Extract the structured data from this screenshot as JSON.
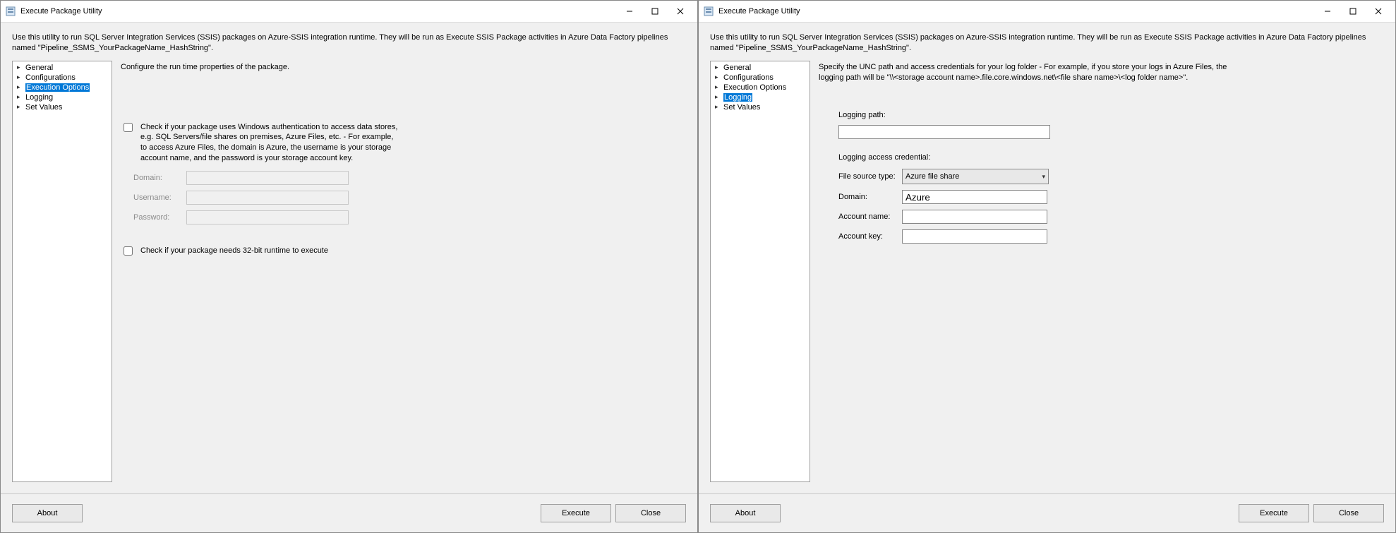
{
  "window_title": "Execute Package Utility",
  "description": "Use this utility to run SQL Server Integration Services (SSIS) packages on Azure-SSIS integration runtime. They will be run as Execute SSIS Package activities in Azure Data Factory pipelines named \"Pipeline_SSMS_YourPackageName_HashString\".",
  "nav": {
    "items": [
      "General",
      "Configurations",
      "Execution Options",
      "Logging",
      "Set Values"
    ]
  },
  "left": {
    "heading": "Configure the run time properties of the package.",
    "auth_checkbox_label": "Check if your package uses Windows authentication to access data stores, e.g. SQL Servers/file shares on premises, Azure Files, etc. - For example, to access Azure Files, the domain is Azure, the username is your storage account name, and the password is your storage account key.",
    "domain_label": "Domain:",
    "username_label": "Username:",
    "password_label": "Password:",
    "domain_value": "",
    "username_value": "",
    "password_value": "",
    "bit32_label": "Check if your package needs 32-bit runtime to execute"
  },
  "right": {
    "heading": "Specify the UNC path and access credentials for your log folder - For example, if you store your logs in Azure Files, the logging path will be \"\\\\<storage account name>.file.core.windows.net\\<file share name>\\<log folder name>\".",
    "logging_path_label": "Logging path:",
    "logging_path_value": "",
    "credential_section": "Logging access credential:",
    "file_source_label": "File source type:",
    "file_source_value": "Azure file share",
    "domain_label": "Domain:",
    "domain_value": "Azure",
    "account_name_label": "Account name:",
    "account_name_value": "",
    "account_key_label": "Account key:",
    "account_key_value": ""
  },
  "buttons": {
    "about": "About",
    "execute": "Execute",
    "close": "Close"
  }
}
